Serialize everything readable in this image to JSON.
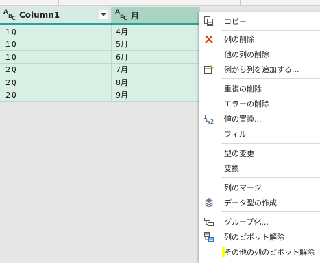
{
  "table": {
    "columns": [
      {
        "type": "ABC",
        "name": "Column1"
      },
      {
        "type": "ABC",
        "name": "月"
      }
    ],
    "rows": [
      [
        "１Q",
        "4月"
      ],
      [
        "１Q",
        "5月"
      ],
      [
        "１Q",
        "6月"
      ],
      [
        "２Q",
        "7月"
      ],
      [
        "２Q",
        "8月"
      ],
      [
        "２Q",
        "9月"
      ]
    ]
  },
  "context_menu": {
    "items": [
      {
        "label": "コピー",
        "icon": "copy-icon"
      },
      {
        "label": "列の削除",
        "icon": "delete-x-icon"
      },
      {
        "label": "他の列の削除",
        "icon": ""
      },
      {
        "label": "例から列を追加する...",
        "icon": "column-from-examples-icon"
      },
      {
        "label": "重複の削除",
        "icon": ""
      },
      {
        "label": "エラーの削除",
        "icon": ""
      },
      {
        "label": "値の置換...",
        "icon": "replace-values-icon"
      },
      {
        "label": "フィル",
        "icon": ""
      },
      {
        "label": "型の変更",
        "icon": ""
      },
      {
        "label": "変換",
        "icon": ""
      },
      {
        "label": "列のマージ",
        "icon": ""
      },
      {
        "label": "データ型の作成",
        "icon": "data-type-icon"
      },
      {
        "label": "グループ化...",
        "icon": "group-by-icon"
      },
      {
        "label": "列のピボット解除",
        "icon": "unpivot-icon"
      },
      {
        "label": "その他の列のピボット解除",
        "icon": ""
      }
    ]
  },
  "colors": {
    "header_accent": "#2aa198",
    "selected_header": "#a9d4c2",
    "cell_background": "#d8efe4",
    "delete_icon": "#d83b01",
    "highlight": "#ffff00"
  }
}
